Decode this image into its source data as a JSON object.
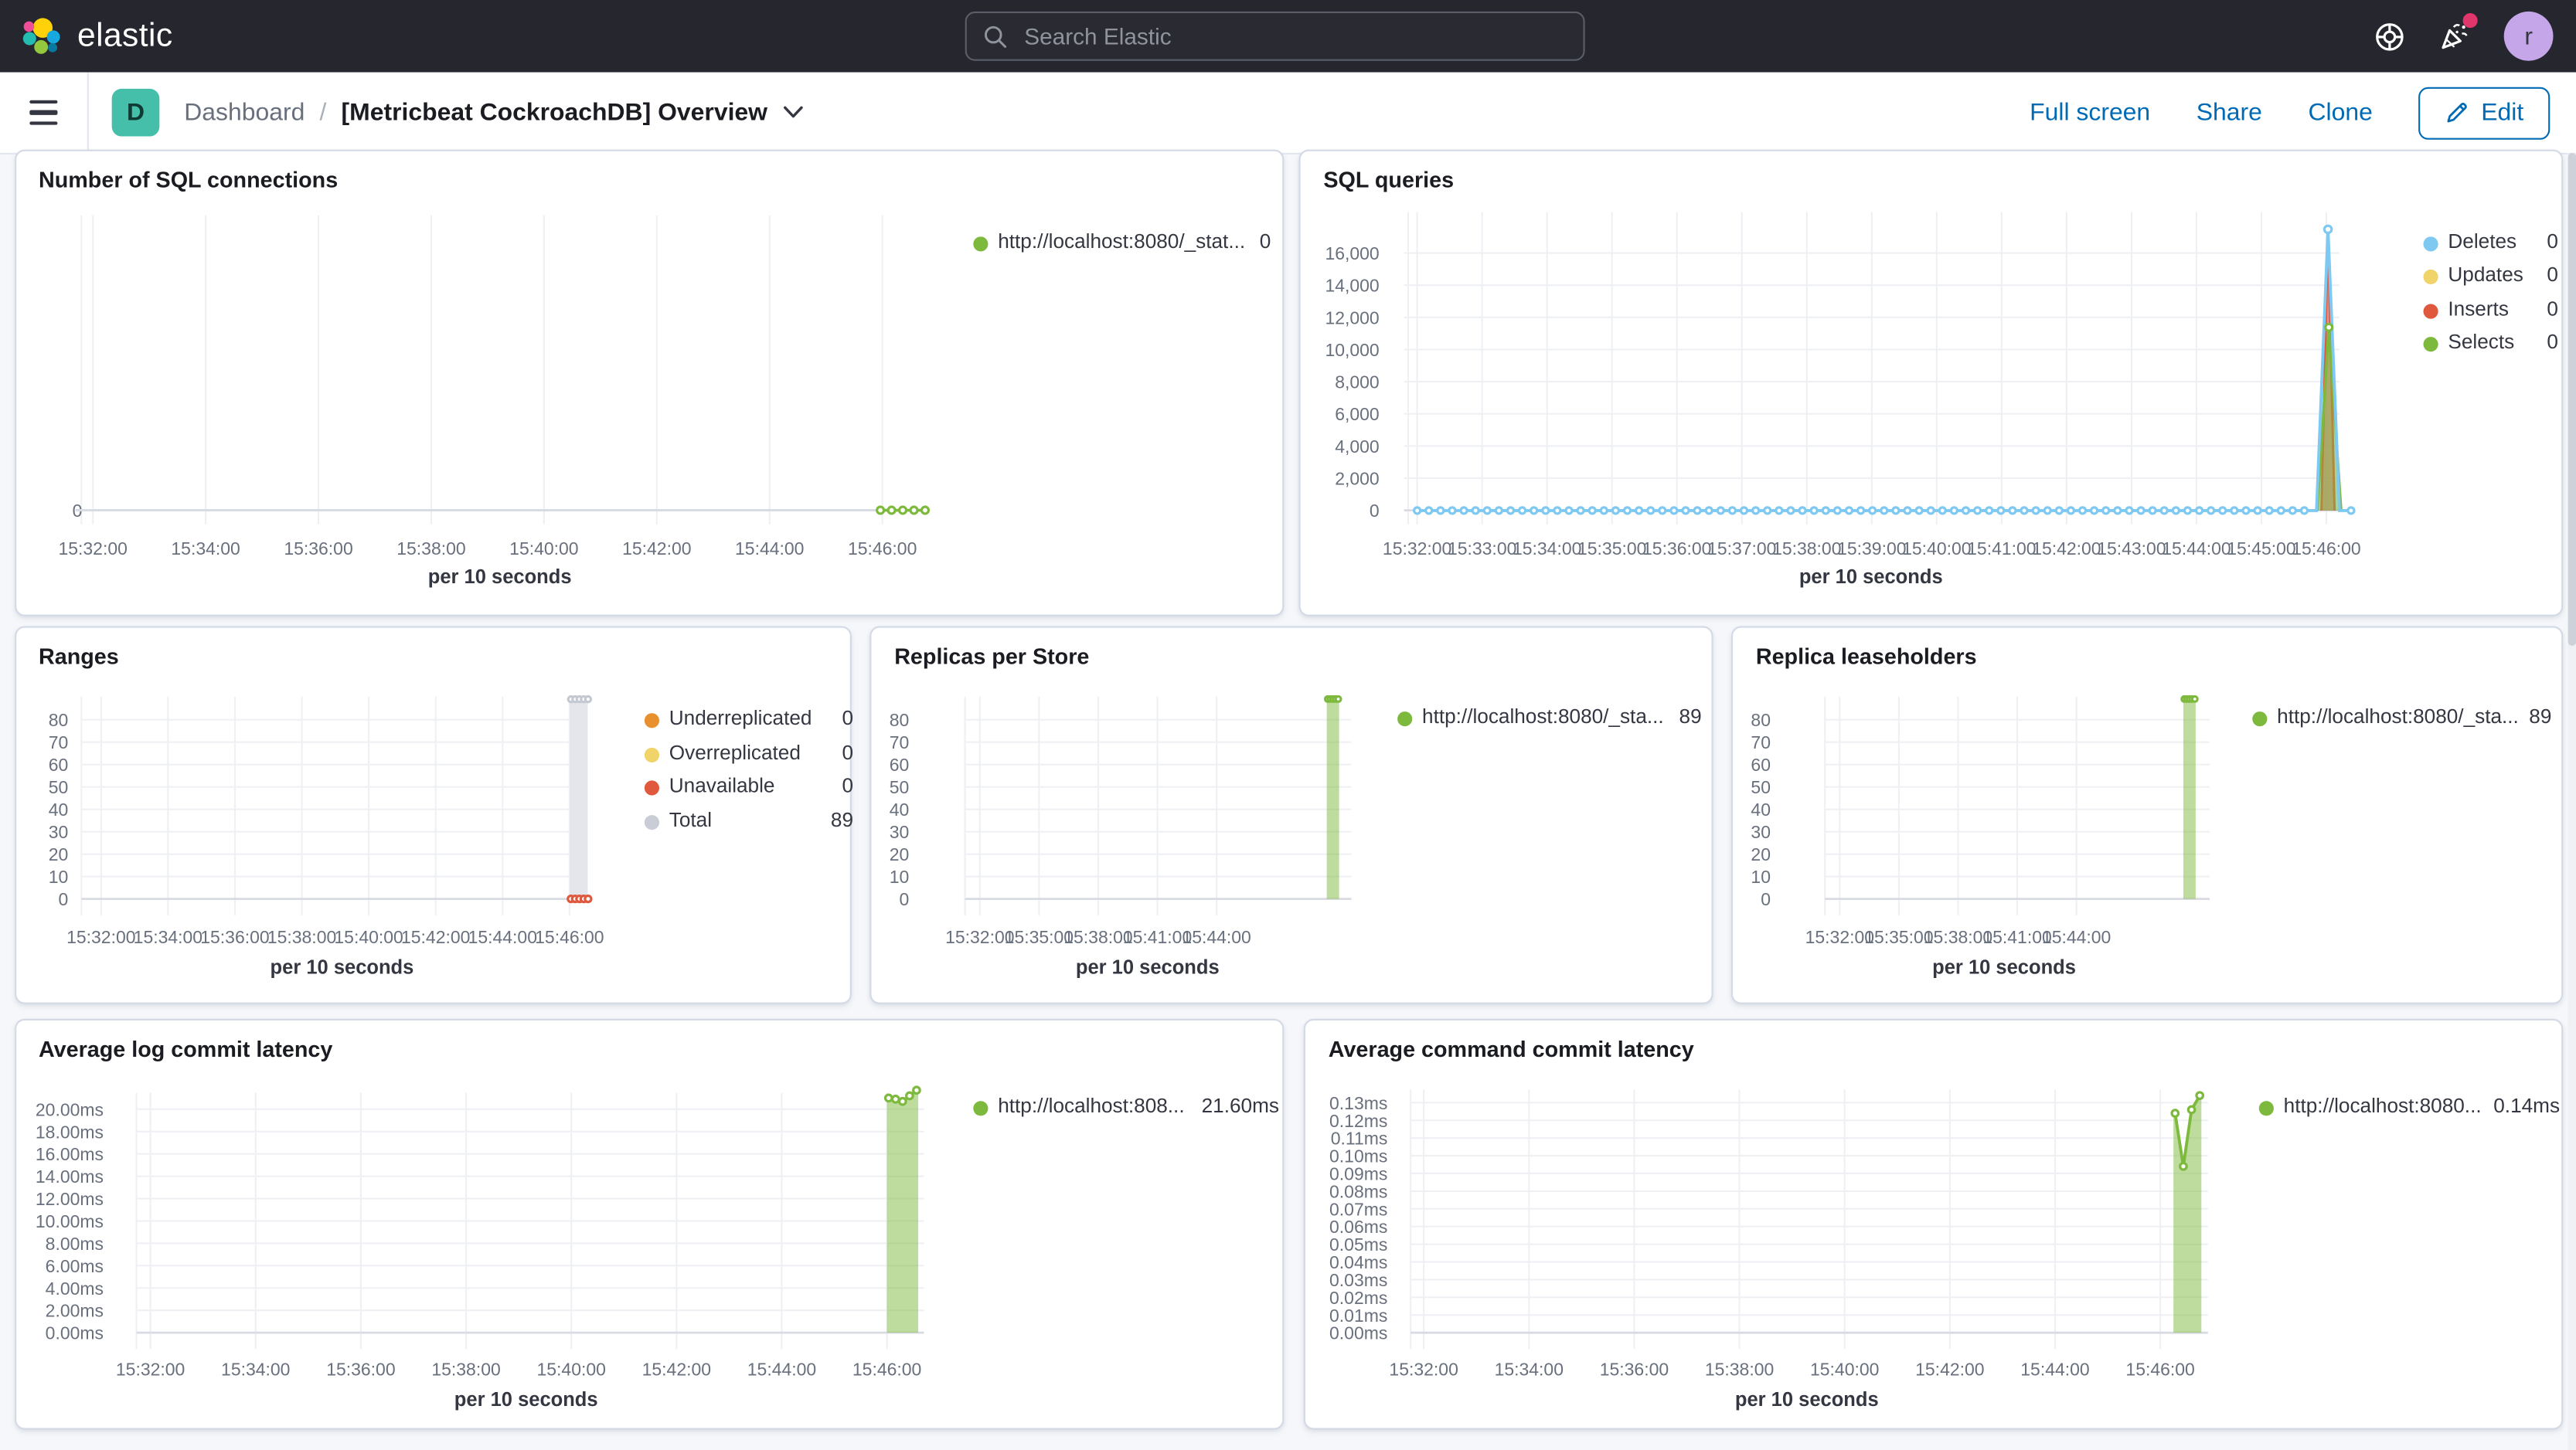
{
  "header": {
    "brand": "elastic",
    "search_placeholder": "Search Elastic",
    "avatar_initial": "r"
  },
  "toolbar": {
    "badge": "D",
    "breadcrumb_root": "Dashboard",
    "breadcrumb_separator": "/",
    "title": "[Metricbeat CockroachDB] Overview",
    "full_screen_label": "Full screen",
    "share_label": "Share",
    "clone_label": "Clone",
    "edit_label": "Edit"
  },
  "panels": [
    {
      "id": "number-of-sql-connections",
      "title": "Number of SQL connections",
      "x_label": "per 10 seconds",
      "x_ticks": [
        "15:32:00",
        "15:34:00",
        "15:36:00",
        "15:38:00",
        "15:40:00",
        "15:42:00",
        "15:44:00",
        "15:46:00"
      ],
      "y_ticks": [
        "0"
      ],
      "legend": [
        {
          "label": "http://localhost:8080/_stat...",
          "value": "0",
          "color": "#7DB93C"
        }
      ]
    },
    {
      "id": "sql-queries",
      "title": "SQL queries",
      "x_label": "per 10 seconds",
      "x_ticks": [
        "15:32:00",
        "15:33:00",
        "15:34:00",
        "15:35:00",
        "15:36:00",
        "15:37:00",
        "15:38:00",
        "15:39:00",
        "15:40:00",
        "15:41:00",
        "15:42:00",
        "15:43:00",
        "15:44:00",
        "15:45:00",
        "15:46:00"
      ],
      "y_ticks": [
        "16,000",
        "14,000",
        "12,000",
        "10,000",
        "8,000",
        "6,000",
        "4,000",
        "2,000",
        "0"
      ],
      "legend": [
        {
          "label": "Deletes",
          "value": "0",
          "color": "#7EC9F1"
        },
        {
          "label": "Updates",
          "value": "0",
          "color": "#F0D469"
        },
        {
          "label": "Inserts",
          "value": "0",
          "color": "#E0583E"
        },
        {
          "label": "Selects",
          "value": "0",
          "color": "#7DB93C"
        }
      ]
    },
    {
      "id": "ranges",
      "title": "Ranges",
      "x_label": "per 10 seconds",
      "x_ticks": [
        "15:32:00",
        "15:34:00",
        "15:36:00",
        "15:38:00",
        "15:40:00",
        "15:42:00",
        "15:44:00",
        "15:46:00"
      ],
      "y_ticks": [
        "80",
        "70",
        "60",
        "50",
        "40",
        "30",
        "20",
        "10",
        "0"
      ],
      "legend": [
        {
          "label": "Underreplicated",
          "value": "0",
          "color": "#E8902E"
        },
        {
          "label": "Overreplicated",
          "value": "0",
          "color": "#F0D469"
        },
        {
          "label": "Unavailable",
          "value": "0",
          "color": "#E0583E"
        },
        {
          "label": "Total",
          "value": "89",
          "color": "#CACDD6"
        }
      ]
    },
    {
      "id": "replicas-per-store",
      "title": "Replicas per Store",
      "x_label": "per 10 seconds",
      "x_ticks": [
        "15:32:00",
        "15:35:00",
        "15:38:00",
        "15:41:00",
        "15:44:00"
      ],
      "y_ticks": [
        "80",
        "70",
        "60",
        "50",
        "40",
        "30",
        "20",
        "10",
        "0"
      ],
      "legend": [
        {
          "label": "http://localhost:8080/_sta...",
          "value": "89",
          "color": "#7DB93C"
        }
      ]
    },
    {
      "id": "replica-leaseholders",
      "title": "Replica leaseholders",
      "x_label": "per 10 seconds",
      "x_ticks": [
        "15:32:00",
        "15:35:00",
        "15:38:00",
        "15:41:00",
        "15:44:00"
      ],
      "y_ticks": [
        "80",
        "70",
        "60",
        "50",
        "40",
        "30",
        "20",
        "10",
        "0"
      ],
      "legend": [
        {
          "label": "http://localhost:8080/_sta...",
          "value": "89",
          "color": "#7DB93C"
        }
      ]
    },
    {
      "id": "average-log-commit-latency",
      "title": "Average log commit latency",
      "x_label": "per 10 seconds",
      "x_ticks": [
        "15:32:00",
        "15:34:00",
        "15:36:00",
        "15:38:00",
        "15:40:00",
        "15:42:00",
        "15:44:00",
        "15:46:00"
      ],
      "y_ticks": [
        "20.00ms",
        "18.00ms",
        "16.00ms",
        "14.00ms",
        "12.00ms",
        "10.00ms",
        "8.00ms",
        "6.00ms",
        "4.00ms",
        "2.00ms",
        "0.00ms"
      ],
      "legend": [
        {
          "label": "http://localhost:808...",
          "value": "21.60ms",
          "color": "#7DB93C"
        }
      ]
    },
    {
      "id": "average-command-commit-latency",
      "title": "Average command commit latency",
      "x_label": "per 10 seconds",
      "x_ticks": [
        "15:32:00",
        "15:34:00",
        "15:36:00",
        "15:38:00",
        "15:40:00",
        "15:42:00",
        "15:44:00",
        "15:46:00"
      ],
      "y_ticks": [
        "0.13ms",
        "0.12ms",
        "0.11ms",
        "0.10ms",
        "0.09ms",
        "0.08ms",
        "0.07ms",
        "0.06ms",
        "0.05ms",
        "0.04ms",
        "0.03ms",
        "0.02ms",
        "0.01ms",
        "0.00ms"
      ],
      "legend": [
        {
          "label": "http://localhost:8080...",
          "value": "0.14ms",
          "color": "#7DB93C"
        }
      ]
    }
  ],
  "chart_data": [
    {
      "panel_id": "number-of-sql-connections",
      "type": "line",
      "title": "Number of SQL connections",
      "xlabel": "per 10 seconds",
      "x_range": [
        "15:32:00",
        "15:46:40"
      ],
      "ylim": [
        0,
        1
      ],
      "series": [
        {
          "name": "http://localhost:8080/_stat...",
          "color": "#7DB93C",
          "current_value": 0,
          "points": [
            {
              "t": "15:45:55",
              "v": 0
            },
            {
              "t": "15:46:05",
              "v": 0
            },
            {
              "t": "15:46:15",
              "v": 0
            },
            {
              "t": "15:46:25",
              "v": 0
            },
            {
              "t": "15:46:35",
              "v": 0
            }
          ]
        }
      ]
    },
    {
      "panel_id": "sql-queries",
      "type": "line",
      "title": "SQL queries",
      "xlabel": "per 10 seconds",
      "x_range": [
        "15:32:00",
        "15:46:30"
      ],
      "ylim": [
        0,
        17600
      ],
      "series": [
        {
          "name": "Deletes",
          "color": "#7EC9F1",
          "baseline": 0,
          "spike_time": "15:46:00",
          "spike_value": 17500,
          "current_value": 0
        },
        {
          "name": "Updates",
          "color": "#F0D469",
          "baseline": 0,
          "spike_value": 0,
          "current_value": 0
        },
        {
          "name": "Inserts",
          "color": "#E0583E",
          "spike_time": "15:46:00",
          "spike_value": 17300,
          "current_value": 0
        },
        {
          "name": "Selects",
          "color": "#7DB93C",
          "spike_time": "15:46:00",
          "spike_value": 11400,
          "current_value": 0
        }
      ]
    },
    {
      "panel_id": "ranges",
      "type": "area",
      "title": "Ranges",
      "xlabel": "per 10 seconds",
      "ylim": [
        0,
        89
      ],
      "series": [
        {
          "name": "Underreplicated",
          "color": "#E8902E",
          "value": 0
        },
        {
          "name": "Overreplicated",
          "color": "#F0D469",
          "value": 0
        },
        {
          "name": "Unavailable",
          "color": "#E0583E",
          "value": 0,
          "window": [
            "15:45:55",
            "15:46:20"
          ]
        },
        {
          "name": "Total",
          "color": "#CACDD6",
          "value": 89,
          "window": [
            "15:45:55",
            "15:46:20"
          ]
        }
      ]
    },
    {
      "panel_id": "replicas-per-store",
      "type": "area",
      "title": "Replicas per Store",
      "xlabel": "per 10 seconds",
      "ylim": [
        0,
        89
      ],
      "series": [
        {
          "name": "http://localhost:8080/_sta...",
          "color": "#7DB93C",
          "value": 89,
          "window": [
            "15:45:55",
            "15:46:20"
          ]
        }
      ]
    },
    {
      "panel_id": "replica-leaseholders",
      "type": "area",
      "title": "Replica leaseholders",
      "xlabel": "per 10 seconds",
      "ylim": [
        0,
        89
      ],
      "series": [
        {
          "name": "http://localhost:8080/_sta...",
          "color": "#7DB93C",
          "value": 89,
          "window": [
            "15:45:55",
            "15:46:20"
          ]
        }
      ]
    },
    {
      "panel_id": "average-log-commit-latency",
      "type": "area",
      "title": "Average log commit latency",
      "xlabel": "per 10 seconds",
      "ylim_ms": [
        0,
        22
      ],
      "series": [
        {
          "name": "http://localhost:808...",
          "color": "#7DB93C",
          "current_value_ms": 21.6,
          "points_ms": [
            21.0,
            20.9,
            20.7,
            21.2,
            21.7
          ],
          "window": [
            "15:45:55",
            "15:46:35"
          ]
        }
      ]
    },
    {
      "panel_id": "average-command-commit-latency",
      "type": "area",
      "title": "Average command commit latency",
      "xlabel": "per 10 seconds",
      "ylim_ms": [
        0,
        0.14
      ],
      "series": [
        {
          "name": "http://localhost:8080...",
          "color": "#7DB93C",
          "current_value_ms": 0.14,
          "points_ms": [
            0.124,
            0.094,
            0.126,
            0.134
          ],
          "window": [
            "15:46:00",
            "15:46:30"
          ]
        }
      ]
    }
  ]
}
